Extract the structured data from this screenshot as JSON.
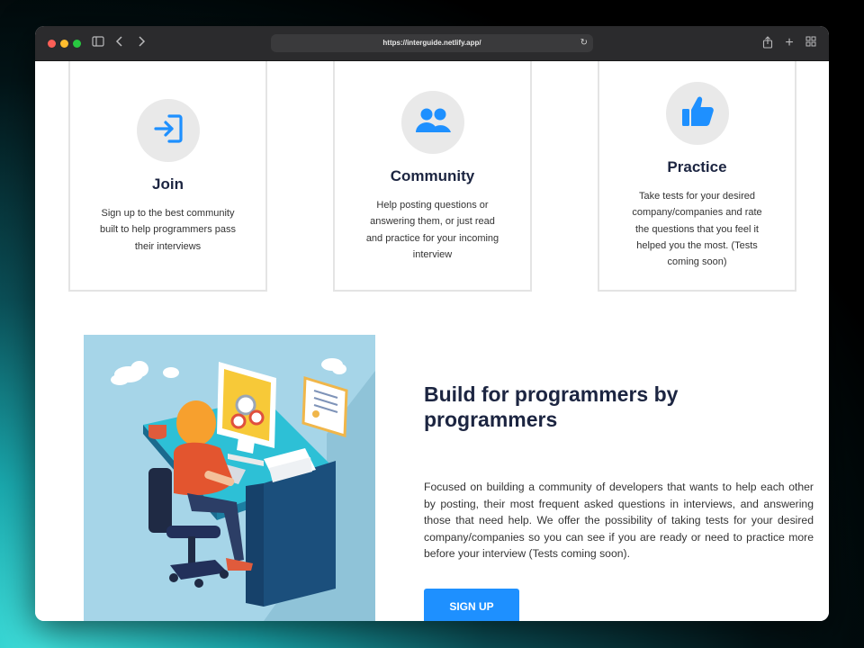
{
  "browser": {
    "url": "https://interguide.netlify.app/"
  },
  "cards": [
    {
      "title": "Join",
      "text": "Sign up to the best community built to help programmers pass their interviews",
      "icon": "sign-in-icon"
    },
    {
      "title": "Community",
      "text": "Help posting questions or answering them, or just read and practice for your incoming interview",
      "icon": "users-icon"
    },
    {
      "title": "Practice",
      "text": "Take tests for your desired company/companies and rate the questions that you feel it helped you the most. (Tests coming soon)",
      "icon": "thumbs-up-icon"
    }
  ],
  "promo": {
    "title": "Build for programmers by programmers",
    "text": "Focused on building a community of developers that wants to help each other by posting, their most frequent asked questions in interviews, and answering those that need help. We offer the possibility of taking tests for your desired company/companies so you can see if you are ready or need to practice more before your interview (Tests coming soon).",
    "button_label": "SIGN UP"
  },
  "colors": {
    "accent": "#1e90ff",
    "heading": "#1c2541",
    "icon_bg": "#e9e9e9"
  }
}
